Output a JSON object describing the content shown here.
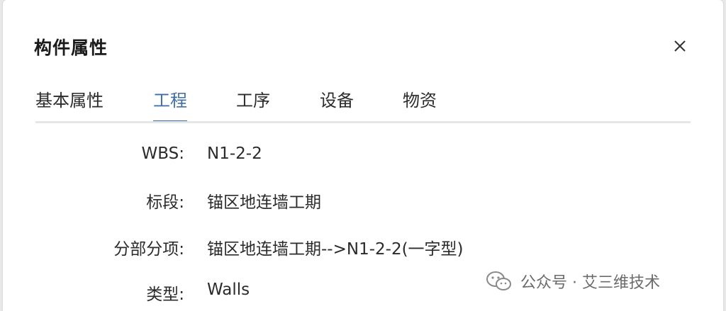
{
  "dialog": {
    "title": "构件属性",
    "close_icon": "close-icon"
  },
  "tabs": [
    {
      "label": "基本属性",
      "active": false
    },
    {
      "label": "工程",
      "active": true
    },
    {
      "label": "工序",
      "active": false
    },
    {
      "label": "设备",
      "active": false
    },
    {
      "label": "物资",
      "active": false
    }
  ],
  "fields": [
    {
      "label": "WBS:",
      "value": "N1-2-2"
    },
    {
      "label": "标段:",
      "value": "锚区地连墙工期"
    },
    {
      "label": "分部分项:",
      "value": "锚区地连墙工期-->N1-2-2(一字型)"
    },
    {
      "label": "类型:",
      "value": "Walls"
    }
  ],
  "watermark": {
    "text": "公众号 · 艾三维技术",
    "icon": "wechat-icon"
  },
  "colors": {
    "accent": "#3f6ea5",
    "text": "#2b2b2b",
    "divider": "#e6e6e6"
  }
}
